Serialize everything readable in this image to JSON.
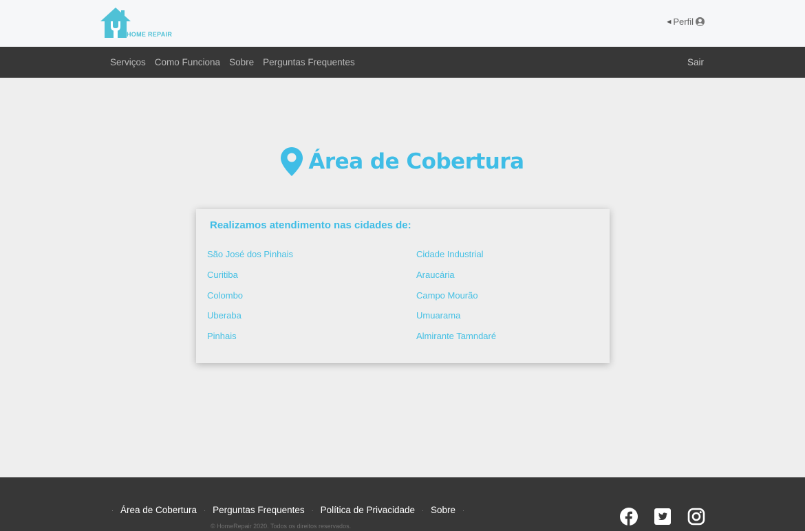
{
  "brand": {
    "logo_text": "HOME REPAIR",
    "color": "#4fc1d6"
  },
  "header": {
    "profile_label": "Perfil"
  },
  "nav": {
    "links": [
      "Serviços",
      "Como Funciona",
      "Sobre",
      "Perguntas Frequentes"
    ],
    "logout_label": "Sair"
  },
  "main": {
    "title": "Área de Cobertura",
    "accent_color": "#3fbde6",
    "card_title": "Realizamos atendimento nas cidades de:",
    "cities_left": [
      "São José dos Pinhais",
      "Curitiba",
      "Colombo",
      "Uberaba",
      "Pinhais"
    ],
    "cities_right": [
      "Cidade Industrial",
      "Araucária",
      "Campo Mourão",
      "Umuarama",
      "Almirante Tamndaré"
    ]
  },
  "footer": {
    "links": [
      "Área de Cobertura",
      "Perguntas Frequentes",
      "Política de Privacidade",
      "Sobre"
    ],
    "copyright": "© HomeRepair 2020. Todos os direitos reservados.",
    "socials": [
      "facebook-icon",
      "twitter-icon",
      "instagram-icon"
    ]
  }
}
